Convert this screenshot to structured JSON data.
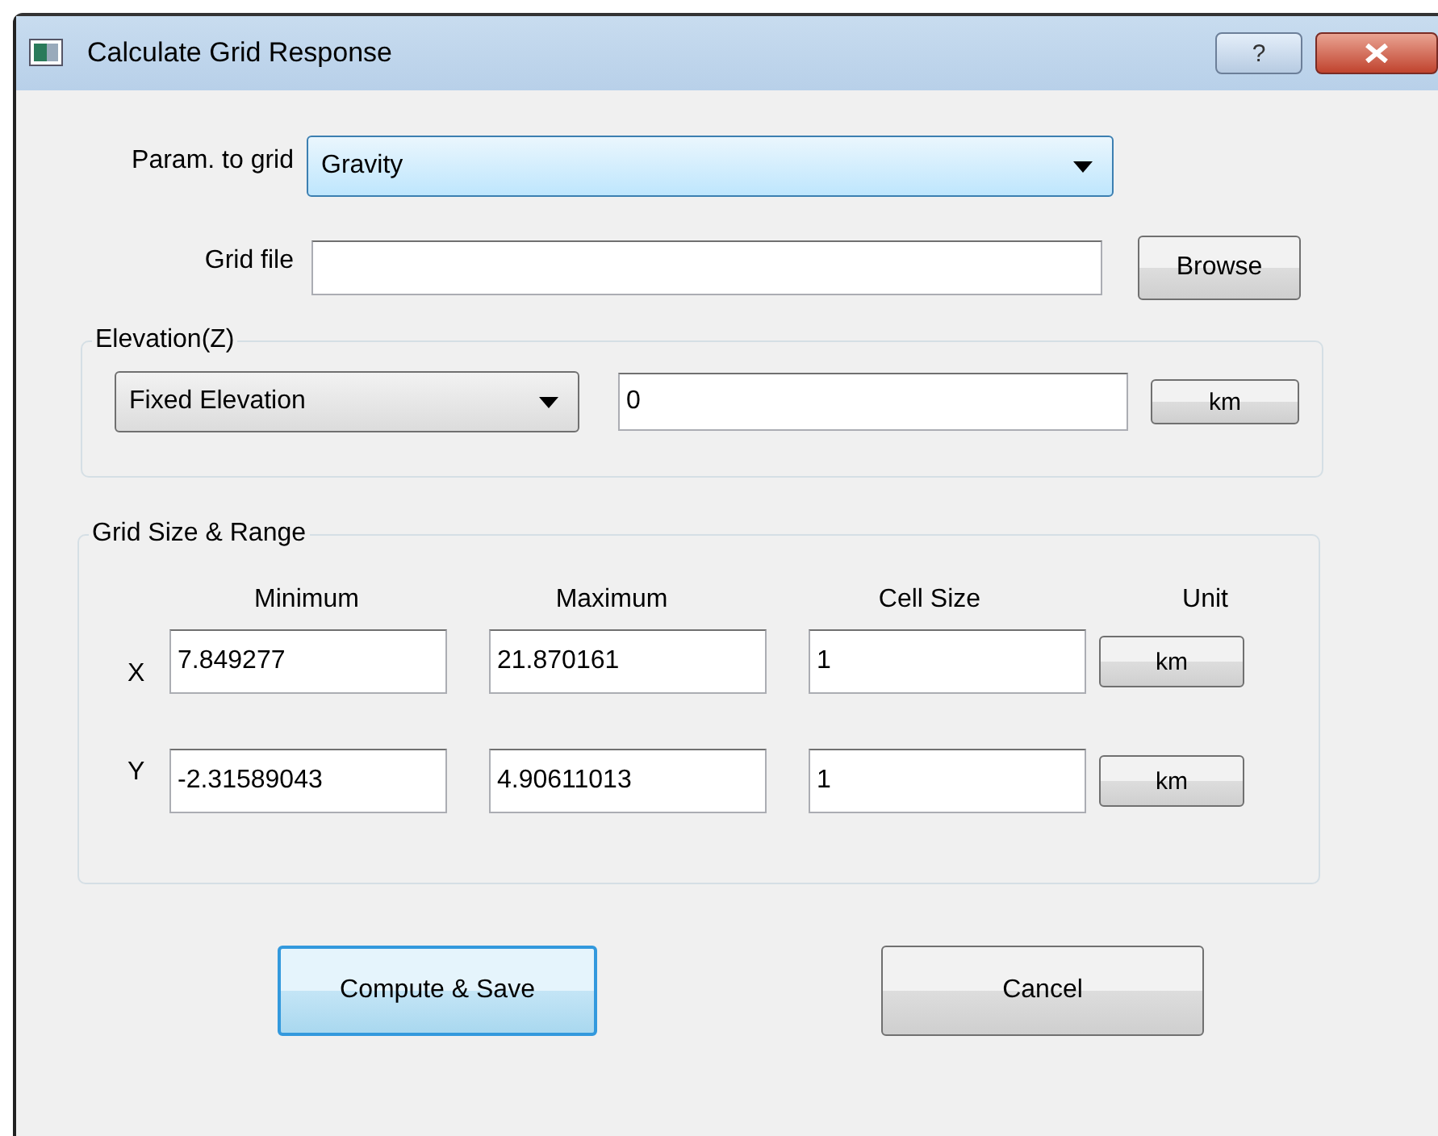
{
  "window": {
    "title": "Calculate Grid Response",
    "help_button": "?"
  },
  "param_to_grid": {
    "label": "Param. to grid",
    "value": "Gravity"
  },
  "grid_file": {
    "label": "Grid file",
    "button": "Browse"
  },
  "elevation": {
    "title": "Elevation(Z)",
    "mode": "Fixed Elevation",
    "value": "0",
    "unit": "km"
  },
  "grid_size_range": {
    "title": "Grid Size & Range",
    "columns": [
      "Minimum",
      "Maximum",
      "Cell Size",
      "Unit"
    ],
    "rows": [
      {
        "axis": "X",
        "minimum": "7.849277",
        "maximum": "21.870161",
        "cell_size": "1",
        "unit": "km"
      },
      {
        "axis": "Y",
        "minimum": "-2.31589043",
        "maximum": "4.90611013",
        "cell_size": "1",
        "unit": "km"
      }
    ]
  },
  "buttons": [
    {
      "label": "Compute & Save",
      "default": true
    },
    {
      "label": "Cancel",
      "default": false
    }
  ]
}
